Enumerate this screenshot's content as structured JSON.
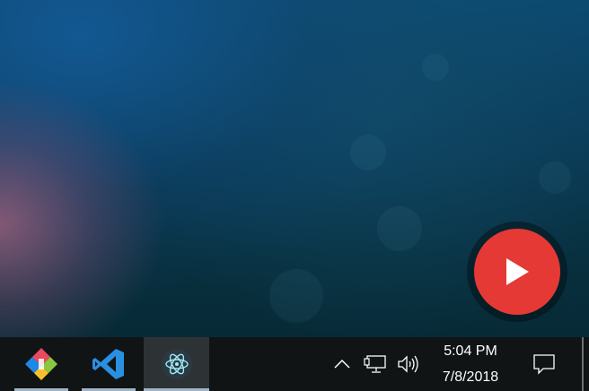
{
  "taskbar": {
    "apps": [
      {
        "name": "pinned-app-1",
        "icon": "colorful-diamond-app-icon",
        "active": false
      },
      {
        "name": "visual-studio-code",
        "icon": "vscode-icon",
        "active": false
      },
      {
        "name": "electron-app",
        "icon": "electron-atom-icon",
        "active": true
      }
    ],
    "tray": {
      "overflow_icon": "chevron-up-icon",
      "network_icon": "network-wired-icon",
      "volume_icon": "speaker-volume-icon",
      "notifications_icon": "action-center-icon"
    },
    "clock": {
      "time": "5:04 PM",
      "date": "7/8/2018"
    }
  },
  "overlay": {
    "play_button_icon": "play-icon",
    "color": "#e53935"
  }
}
